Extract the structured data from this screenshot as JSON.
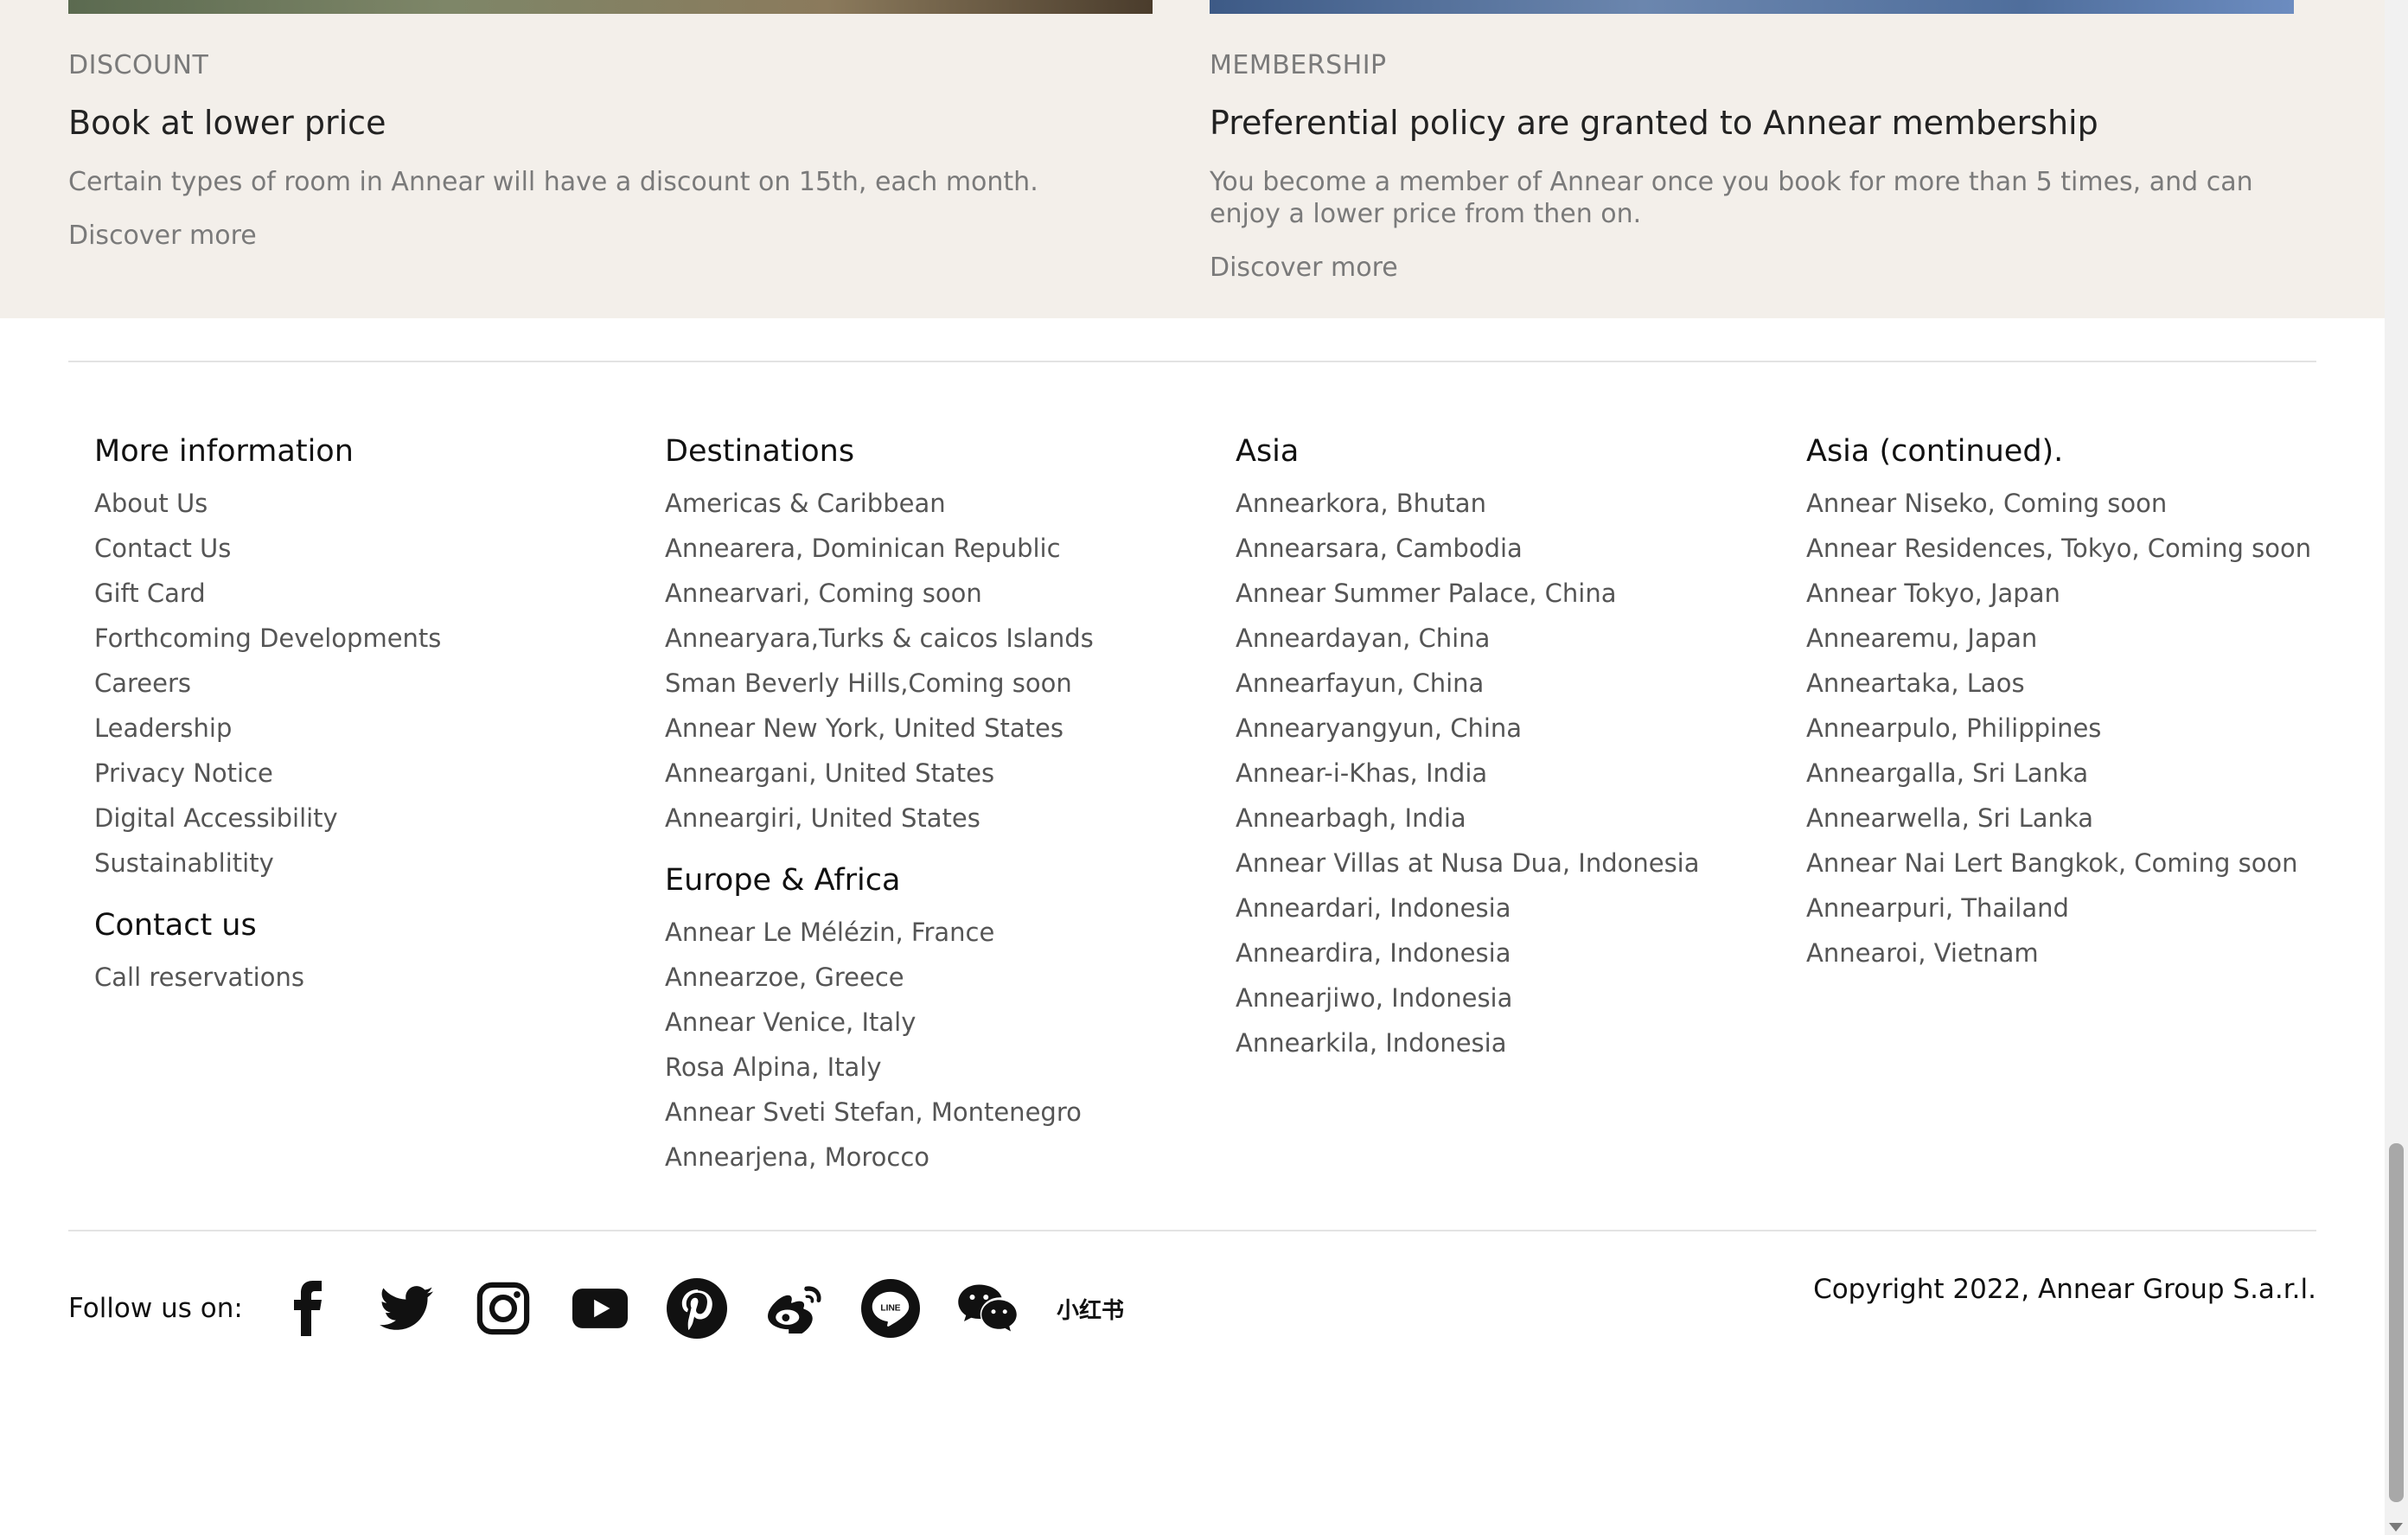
{
  "promos": [
    {
      "tag": "DISCOUNT",
      "title": "Book at lower price",
      "description": "Certain types of room in Annear will have a discount on 15th, each month.",
      "link": "Discover more"
    },
    {
      "tag": "MEMBERSHIP",
      "title": "Preferential policy are granted to Annear membership",
      "description": "You become a member of Annear once you book for more than 5 times, and can enjoy a lower price from then on.",
      "link": "Discover more"
    }
  ],
  "footer": {
    "more_information": {
      "title": "More information",
      "items": [
        "About Us",
        "Contact Us",
        "Gift Card",
        "Forthcoming Developments",
        "Careers",
        "Leadership",
        "Privacy Notice",
        "Digital Accessibility",
        "Sustainablitity"
      ]
    },
    "contact": {
      "title": "Contact us",
      "items": [
        "Call reservations"
      ]
    },
    "destinations": {
      "title": "Destinations",
      "items": [
        "Americas & Caribbean",
        "Annearera, Dominican Republic",
        "Annearvari, Coming soon",
        "Annearyara,Turks & caicos Islands",
        "Sman Beverly Hills,Coming soon",
        "Annear New York, United States",
        "Anneargani, United States",
        "Anneargiri, United States"
      ]
    },
    "europe_africa": {
      "title": "Europe & Africa",
      "items": [
        "Annear Le Mélézin, France",
        "Annearzoe, Greece",
        "Annear Venice, Italy",
        "Rosa Alpina, Italy",
        "Annear Sveti Stefan, Montenegro",
        "Annearjena, Morocco"
      ]
    },
    "asia": {
      "title": "Asia",
      "items": [
        "Annearkora, Bhutan",
        "Annearsara, Cambodia",
        "Annear Summer Palace, China",
        "Anneardayan, China",
        "Annearfayun, China",
        "Annearyangyun, China",
        "Annear-i-Khas, India",
        "Annearbagh, India",
        "Annear Villas at Nusa Dua, Indonesia",
        "Anneardari, Indonesia",
        "Anneardira, Indonesia",
        "Annearjiwo, Indonesia",
        "Annearkila, Indonesia"
      ]
    },
    "asia_continued": {
      "title": "Asia (continued).",
      "items": [
        "Annear Niseko, Coming soon",
        "Annear Residences, Tokyo, Coming soon",
        "Annear Tokyo, Japan",
        "Annearemu, Japan",
        "Anneartaka, Laos",
        "Annearpulo, Philippines",
        "Anneargalla, Sri Lanka",
        "Annearwella, Sri Lanka",
        "Annear Nai Lert Bangkok, Coming soon",
        "Annearpuri, Thailand",
        "Annearoi, Vietnam"
      ]
    },
    "follow_label": "Follow us on:",
    "social_icons": [
      "facebook-icon",
      "twitter-icon",
      "instagram-icon",
      "youtube-icon",
      "pinterest-icon",
      "weibo-icon",
      "line-icon",
      "wechat-icon",
      "xiaohongshu-icon"
    ],
    "xiaohongshu_text": "小红书",
    "copyright": "Copyright 2022, Annear Group S.a.r.l."
  }
}
